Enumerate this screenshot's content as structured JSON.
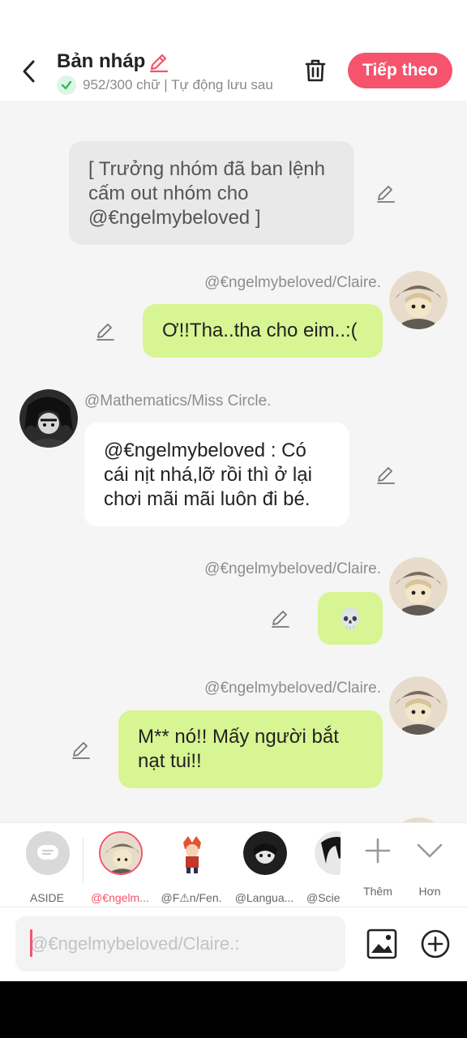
{
  "header": {
    "title": "Bản nháp",
    "subtitle": "952/300 chữ | Tự động lưu sau",
    "next_label": "Tiếp theo"
  },
  "messages": [
    {
      "type": "narration",
      "text": "[ Trưởng nhóm đã ban lệnh cấm out nhóm cho @€ngelmybeloved ]"
    },
    {
      "type": "outgoing",
      "sender": "@€ngelmybeloved/Claire.",
      "text": "Ơ!!Tha..tha cho eim..:("
    },
    {
      "type": "incoming",
      "sender": "@Mathematics/Miss Circle.",
      "text": "@€ngelmybeloved : Có cái nịt nhá,lỡ rồi thì ở lại chơi mãi mãi luôn đi bé."
    },
    {
      "type": "outgoing",
      "sender": "@€ngelmybeloved/Claire.",
      "text": "💀"
    },
    {
      "type": "outgoing",
      "sender": "@€ngelmybeloved/Claire.",
      "text": "M** nó!! Mấy người bắt nạt tui!!"
    }
  ],
  "characters": [
    {
      "label": "ASIDE"
    },
    {
      "label": "@€ngelm..."
    },
    {
      "label": "@F⚠n/Fen."
    },
    {
      "label": "@Langua..."
    },
    {
      "label": "@Scie"
    }
  ],
  "tools": {
    "more_label": "Thêm",
    "expand_label": "Hơn"
  },
  "input": {
    "placeholder": "@€ngelmybeloved/Claire.:"
  },
  "colors": {
    "accent": "#f5546c",
    "bubble_green": "#d7f592",
    "bubble_gray": "#e9e9e9",
    "chat_bg": "#f5f5f5"
  }
}
